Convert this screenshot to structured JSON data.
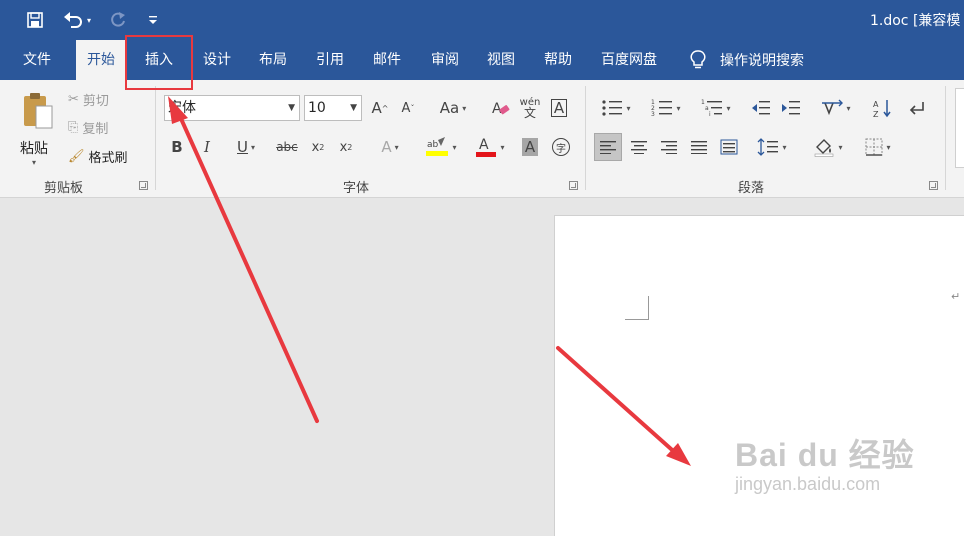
{
  "titlebar": {
    "doc_title": "1.doc [兼容模",
    "colors": {
      "brand": "#2b579a"
    }
  },
  "qat": {
    "save_icon": "save-icon",
    "undo_icon": "undo-icon",
    "redo_icon": "redo-icon",
    "customize_icon": "customize-qat-icon"
  },
  "tabs": [
    {
      "label": "文件"
    },
    {
      "label": "开始"
    },
    {
      "label": "插入"
    },
    {
      "label": "设计"
    },
    {
      "label": "布局"
    },
    {
      "label": "引用"
    },
    {
      "label": "邮件"
    },
    {
      "label": "审阅"
    },
    {
      "label": "视图"
    },
    {
      "label": "帮助"
    },
    {
      "label": "百度网盘"
    }
  ],
  "tell_me": {
    "label": "操作说明搜索",
    "icon": "lightbulb-icon"
  },
  "clipboard": {
    "paste_label": "粘贴",
    "cut_label": "剪切",
    "copy_label": "复制",
    "format_painter_label": "格式刷",
    "group_label": "剪贴板"
  },
  "font": {
    "font_name": "宋体",
    "font_size": "10",
    "group_label": "字体",
    "colors": {
      "highlight": "#ffff00",
      "font_color": "#ff0000"
    }
  },
  "paragraph": {
    "group_label": "段落"
  },
  "watermark": {
    "main": "Bai du 经验",
    "sub": "jingyan.baidu.com"
  },
  "annotation_color": "#e8393f"
}
